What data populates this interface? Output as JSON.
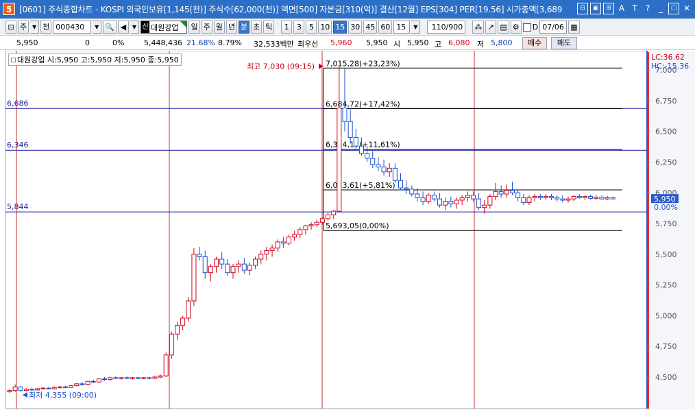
{
  "window": {
    "logo": "5",
    "title": "[0601] 주식종합차트 - KOSPI 외국인보유[1,145(천)] 주식수[62,000(천)] 액면[500] 자본금[310(억)] 결산[12월] EPS[304] PER[19.56] 시가총액[3,689"
  },
  "toolbar": {
    "period_type": "주",
    "prev_label": "전",
    "code": "000430",
    "stock_tag": "신",
    "stock_name": "대원강업",
    "day": "일",
    "week": "주",
    "month": "월",
    "year": "년",
    "minute": "분",
    "second": "초",
    "tick": "틱",
    "intervals": [
      "1",
      "3",
      "5",
      "10",
      "15",
      "30",
      "45",
      "60"
    ],
    "active_interval": "15",
    "interval_select": "15",
    "count": "110/900",
    "d_label": "D",
    "date": "07/06"
  },
  "quote": {
    "price": "5,950",
    "change": "0",
    "change_pct": "0%",
    "volume": "5,448,436",
    "turnover_pct": "21.68%",
    "vol_ratio": "8.79%",
    "amount": "32,533백만",
    "best_label": "최우선",
    "best_ask": "5,960",
    "best_bid": "5,950",
    "open_label": "시",
    "open": "5,950",
    "high_label": "고",
    "high": "6,080",
    "low_label": "저",
    "low": "5,800",
    "buy_label": "매수",
    "sell_label": "매도"
  },
  "chart_legend": "대원강업 시:5,950 고:5,950 저:5,950 종:5,950",
  "chart_data": {
    "type": "candlestick",
    "y_ticks": [
      "7,000",
      "6,750",
      "6,500",
      "6,250",
      "6,000",
      "5,750",
      "5,500",
      "5,250",
      "5,000",
      "4,750",
      "4,500"
    ],
    "ylim": [
      4350,
      7060
    ],
    "lc_label": "LC:36.62",
    "hc_label": "HC:-15.36",
    "current_price": "5,950",
    "current_pct": "0.00%",
    "horizontal_lines": [
      {
        "value": 6686,
        "label": "6,686"
      },
      {
        "value": 6346,
        "label": "6,346"
      },
      {
        "value": 5844,
        "label": "5,844"
      }
    ],
    "fib_levels": [
      {
        "value": 7015.28,
        "label": "7,015,28(+23,23%)"
      },
      {
        "value": 6684.72,
        "label": "6,684,72(+17,42%)"
      },
      {
        "value": 6354.17,
        "label": "6,354,17(+11,61%)"
      },
      {
        "value": 6023.61,
        "label": "6,023,61(+5,81%)"
      },
      {
        "value": 5693.05,
        "label": "5,693,05(0,00%)"
      }
    ],
    "high_marker": "최고 7,030 (09:15)",
    "low_marker": "최저 4,355 (09:00)",
    "day_separators": [
      24,
      247,
      470,
      692
    ],
    "candles": [
      [
        4380,
        4400,
        4370,
        4390
      ],
      [
        4390,
        4440,
        4380,
        4420
      ],
      [
        4420,
        4430,
        4380,
        4390
      ],
      [
        4390,
        4410,
        4385,
        4400
      ],
      [
        4400,
        4415,
        4390,
        4395
      ],
      [
        4395,
        4410,
        4390,
        4405
      ],
      [
        4405,
        4420,
        4400,
        4410
      ],
      [
        4410,
        4420,
        4400,
        4405
      ],
      [
        4405,
        4425,
        4400,
        4415
      ],
      [
        4415,
        4430,
        4405,
        4420
      ],
      [
        4420,
        4430,
        4410,
        4415
      ],
      [
        4415,
        4435,
        4410,
        4430
      ],
      [
        4430,
        4450,
        4425,
        4445
      ],
      [
        4445,
        4460,
        4430,
        4440
      ],
      [
        4440,
        4470,
        4435,
        4465
      ],
      [
        4465,
        4480,
        4450,
        4460
      ],
      [
        4460,
        4490,
        4455,
        4485
      ],
      [
        4485,
        4500,
        4470,
        4480
      ],
      [
        4480,
        4500,
        4470,
        4495
      ],
      [
        4495,
        4505,
        4485,
        4490
      ],
      [
        4490,
        4500,
        4480,
        4495
      ],
      [
        4495,
        4505,
        4485,
        4490
      ],
      [
        4490,
        4500,
        4480,
        4495
      ],
      [
        4495,
        4500,
        4485,
        4490
      ],
      [
        4490,
        4500,
        4485,
        4495
      ],
      [
        4495,
        4500,
        4480,
        4490
      ],
      [
        4490,
        4510,
        4485,
        4500
      ],
      [
        4500,
        4520,
        4490,
        4510
      ],
      [
        4510,
        4700,
        4500,
        4680
      ],
      [
        4680,
        4870,
        4650,
        4850
      ],
      [
        4850,
        4950,
        4800,
        4920
      ],
      [
        4920,
        5000,
        4880,
        4980
      ],
      [
        4980,
        5150,
        4950,
        5120
      ],
      [
        5120,
        5550,
        5080,
        5500
      ],
      [
        5500,
        5560,
        5450,
        5480
      ],
      [
        5480,
        5530,
        5300,
        5350
      ],
      [
        5350,
        5420,
        5280,
        5400
      ],
      [
        5400,
        5480,
        5350,
        5460
      ],
      [
        5460,
        5520,
        5380,
        5420
      ],
      [
        5420,
        5460,
        5320,
        5350
      ],
      [
        5350,
        5420,
        5300,
        5400
      ],
      [
        5400,
        5450,
        5350,
        5420
      ],
      [
        5420,
        5470,
        5340,
        5370
      ],
      [
        5370,
        5430,
        5330,
        5410
      ],
      [
        5410,
        5480,
        5380,
        5460
      ],
      [
        5460,
        5530,
        5420,
        5500
      ],
      [
        5500,
        5560,
        5450,
        5530
      ],
      [
        5530,
        5580,
        5480,
        5550
      ],
      [
        5550,
        5620,
        5520,
        5600
      ],
      [
        5600,
        5640,
        5550,
        5590
      ],
      [
        5590,
        5660,
        5570,
        5640
      ],
      [
        5640,
        5690,
        5610,
        5660
      ],
      [
        5660,
        5720,
        5630,
        5700
      ],
      [
        5700,
        5740,
        5660,
        5730
      ],
      [
        5730,
        5760,
        5700,
        5740
      ],
      [
        5740,
        5780,
        5720,
        5760
      ],
      [
        5760,
        5800,
        5740,
        5790
      ],
      [
        5790,
        5840,
        5770,
        5820
      ],
      [
        5820,
        5860,
        5790,
        5850
      ],
      [
        5850,
        7030,
        5850,
        6690
      ],
      [
        6690,
        7015,
        6500,
        6580
      ],
      [
        6580,
        6680,
        6400,
        6450
      ],
      [
        6450,
        6520,
        6350,
        6380
      ],
      [
        6380,
        6450,
        6300,
        6320
      ],
      [
        6320,
        6380,
        6250,
        6280
      ],
      [
        6280,
        6340,
        6200,
        6230
      ],
      [
        6230,
        6290,
        6180,
        6210
      ],
      [
        6210,
        6270,
        6140,
        6170
      ],
      [
        6170,
        6240,
        6130,
        6200
      ],
      [
        6200,
        6240,
        6080,
        6100
      ],
      [
        6100,
        6160,
        6020,
        6040
      ],
      [
        6040,
        6100,
        5990,
        6030
      ],
      [
        6030,
        6060,
        5970,
        5990
      ],
      [
        5990,
        6040,
        5930,
        5960
      ],
      [
        5960,
        6010,
        5900,
        5930
      ],
      [
        5930,
        6000,
        5910,
        5980
      ],
      [
        5980,
        6010,
        5930,
        5950
      ],
      [
        5950,
        6000,
        5880,
        5900
      ],
      [
        5900,
        5960,
        5860,
        5930
      ],
      [
        5930,
        5970,
        5880,
        5910
      ],
      [
        5910,
        5960,
        5870,
        5940
      ],
      [
        5940,
        5980,
        5900,
        5960
      ],
      [
        5960,
        6010,
        5930,
        5980
      ],
      [
        5980,
        6010,
        5930,
        5950
      ],
      [
        5950,
        6000,
        5860,
        5880
      ],
      [
        5880,
        5940,
        5830,
        5900
      ],
      [
        5900,
        5990,
        5870,
        5970
      ],
      [
        5970,
        6080,
        5940,
        6010
      ],
      [
        6010,
        6060,
        5960,
        5990
      ],
      [
        5990,
        6070,
        5960,
        6020
      ],
      [
        6020,
        6090,
        5980,
        6000
      ],
      [
        6000,
        6030,
        5930,
        5960
      ],
      [
        5960,
        5990,
        5900,
        5920
      ],
      [
        5920,
        5980,
        5900,
        5960
      ],
      [
        5960,
        5990,
        5930,
        5970
      ],
      [
        5970,
        5990,
        5940,
        5960
      ],
      [
        5960,
        5990,
        5940,
        5970
      ],
      [
        5970,
        5990,
        5940,
        5960
      ],
      [
        5960,
        5980,
        5930,
        5950
      ],
      [
        5950,
        5980,
        5920,
        5940
      ],
      [
        5940,
        5970,
        5920,
        5950
      ],
      [
        5950,
        5980,
        5930,
        5970
      ],
      [
        5970,
        5990,
        5950,
        5960
      ],
      [
        5960,
        5980,
        5940,
        5970
      ],
      [
        5970,
        5985,
        5945,
        5955
      ],
      [
        5955,
        5980,
        5940,
        5965
      ],
      [
        5965,
        5980,
        5945,
        5950
      ],
      [
        5950,
        5975,
        5940,
        5960
      ],
      [
        5960,
        5970,
        5945,
        5950
      ]
    ]
  }
}
